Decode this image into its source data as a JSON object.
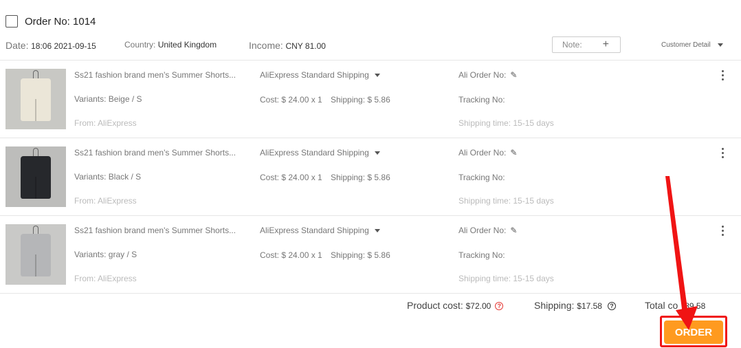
{
  "header": {
    "order_no": "Order No: 1014",
    "date_label": "Date:",
    "date_value": "18:06 2021-09-15",
    "country_label": "Country:",
    "country_value": "United Kingdom",
    "income_label": "Income:",
    "income_value": "CNY 81.00",
    "note_label": "Note:",
    "note_add": "+",
    "customer_detail": "Customer Detail"
  },
  "items": [
    {
      "title": "Ss21 fashion brand men's Summer Shorts...",
      "variants": "Variants: Beige / S",
      "from": "From: AliExpress",
      "shipping_method": "AliExpress Standard Shipping",
      "cost": "Cost: $ 24.00 x 1",
      "shipping": "Shipping: $ 5.86",
      "ali_order": "Ali Order No:",
      "tracking": "Tracking No:",
      "shipping_time": "Shipping time: 15-15 days",
      "image_color": "#ebe6d8",
      "image_bg": "#c8c8c4"
    },
    {
      "title": "Ss21 fashion brand men's Summer Shorts...",
      "variants": "Variants: Black / S",
      "from": "From: AliExpress",
      "shipping_method": "AliExpress Standard Shipping",
      "cost": "Cost: $ 24.00 x 1",
      "shipping": "Shipping: $ 5.86",
      "ali_order": "Ali Order No:",
      "tracking": "Tracking No:",
      "shipping_time": "Shipping time: 15-15 days",
      "image_color": "#26282c",
      "image_bg": "#bdbdbb"
    },
    {
      "title": "Ss21 fashion brand men's Summer Shorts...",
      "variants": "Variants: gray / S",
      "from": "From: AliExpress",
      "shipping_method": "AliExpress Standard Shipping",
      "cost": "Cost: $ 24.00 x 1",
      "shipping": "Shipping: $ 5.86",
      "ali_order": "Ali Order No:",
      "tracking": "Tracking No:",
      "shipping_time": "Shipping time: 15-15 days",
      "image_color": "#b5b6b8",
      "image_bg": "#c9c9c7"
    }
  ],
  "summary": {
    "product_cost_label": "Product cost:",
    "product_cost_value": "$72.00",
    "shipping_label": "Shipping:",
    "shipping_value": "$17.58",
    "total_label": "Total co",
    "total_value": "89.58"
  },
  "order_button": "ORDER",
  "colors": {
    "accent_orange": "#ff9a1f",
    "annotation_red": "#f01414"
  },
  "icons": {
    "edit": "pencil-icon",
    "help": "question-circle-icon",
    "more": "more-vertical-icon"
  }
}
